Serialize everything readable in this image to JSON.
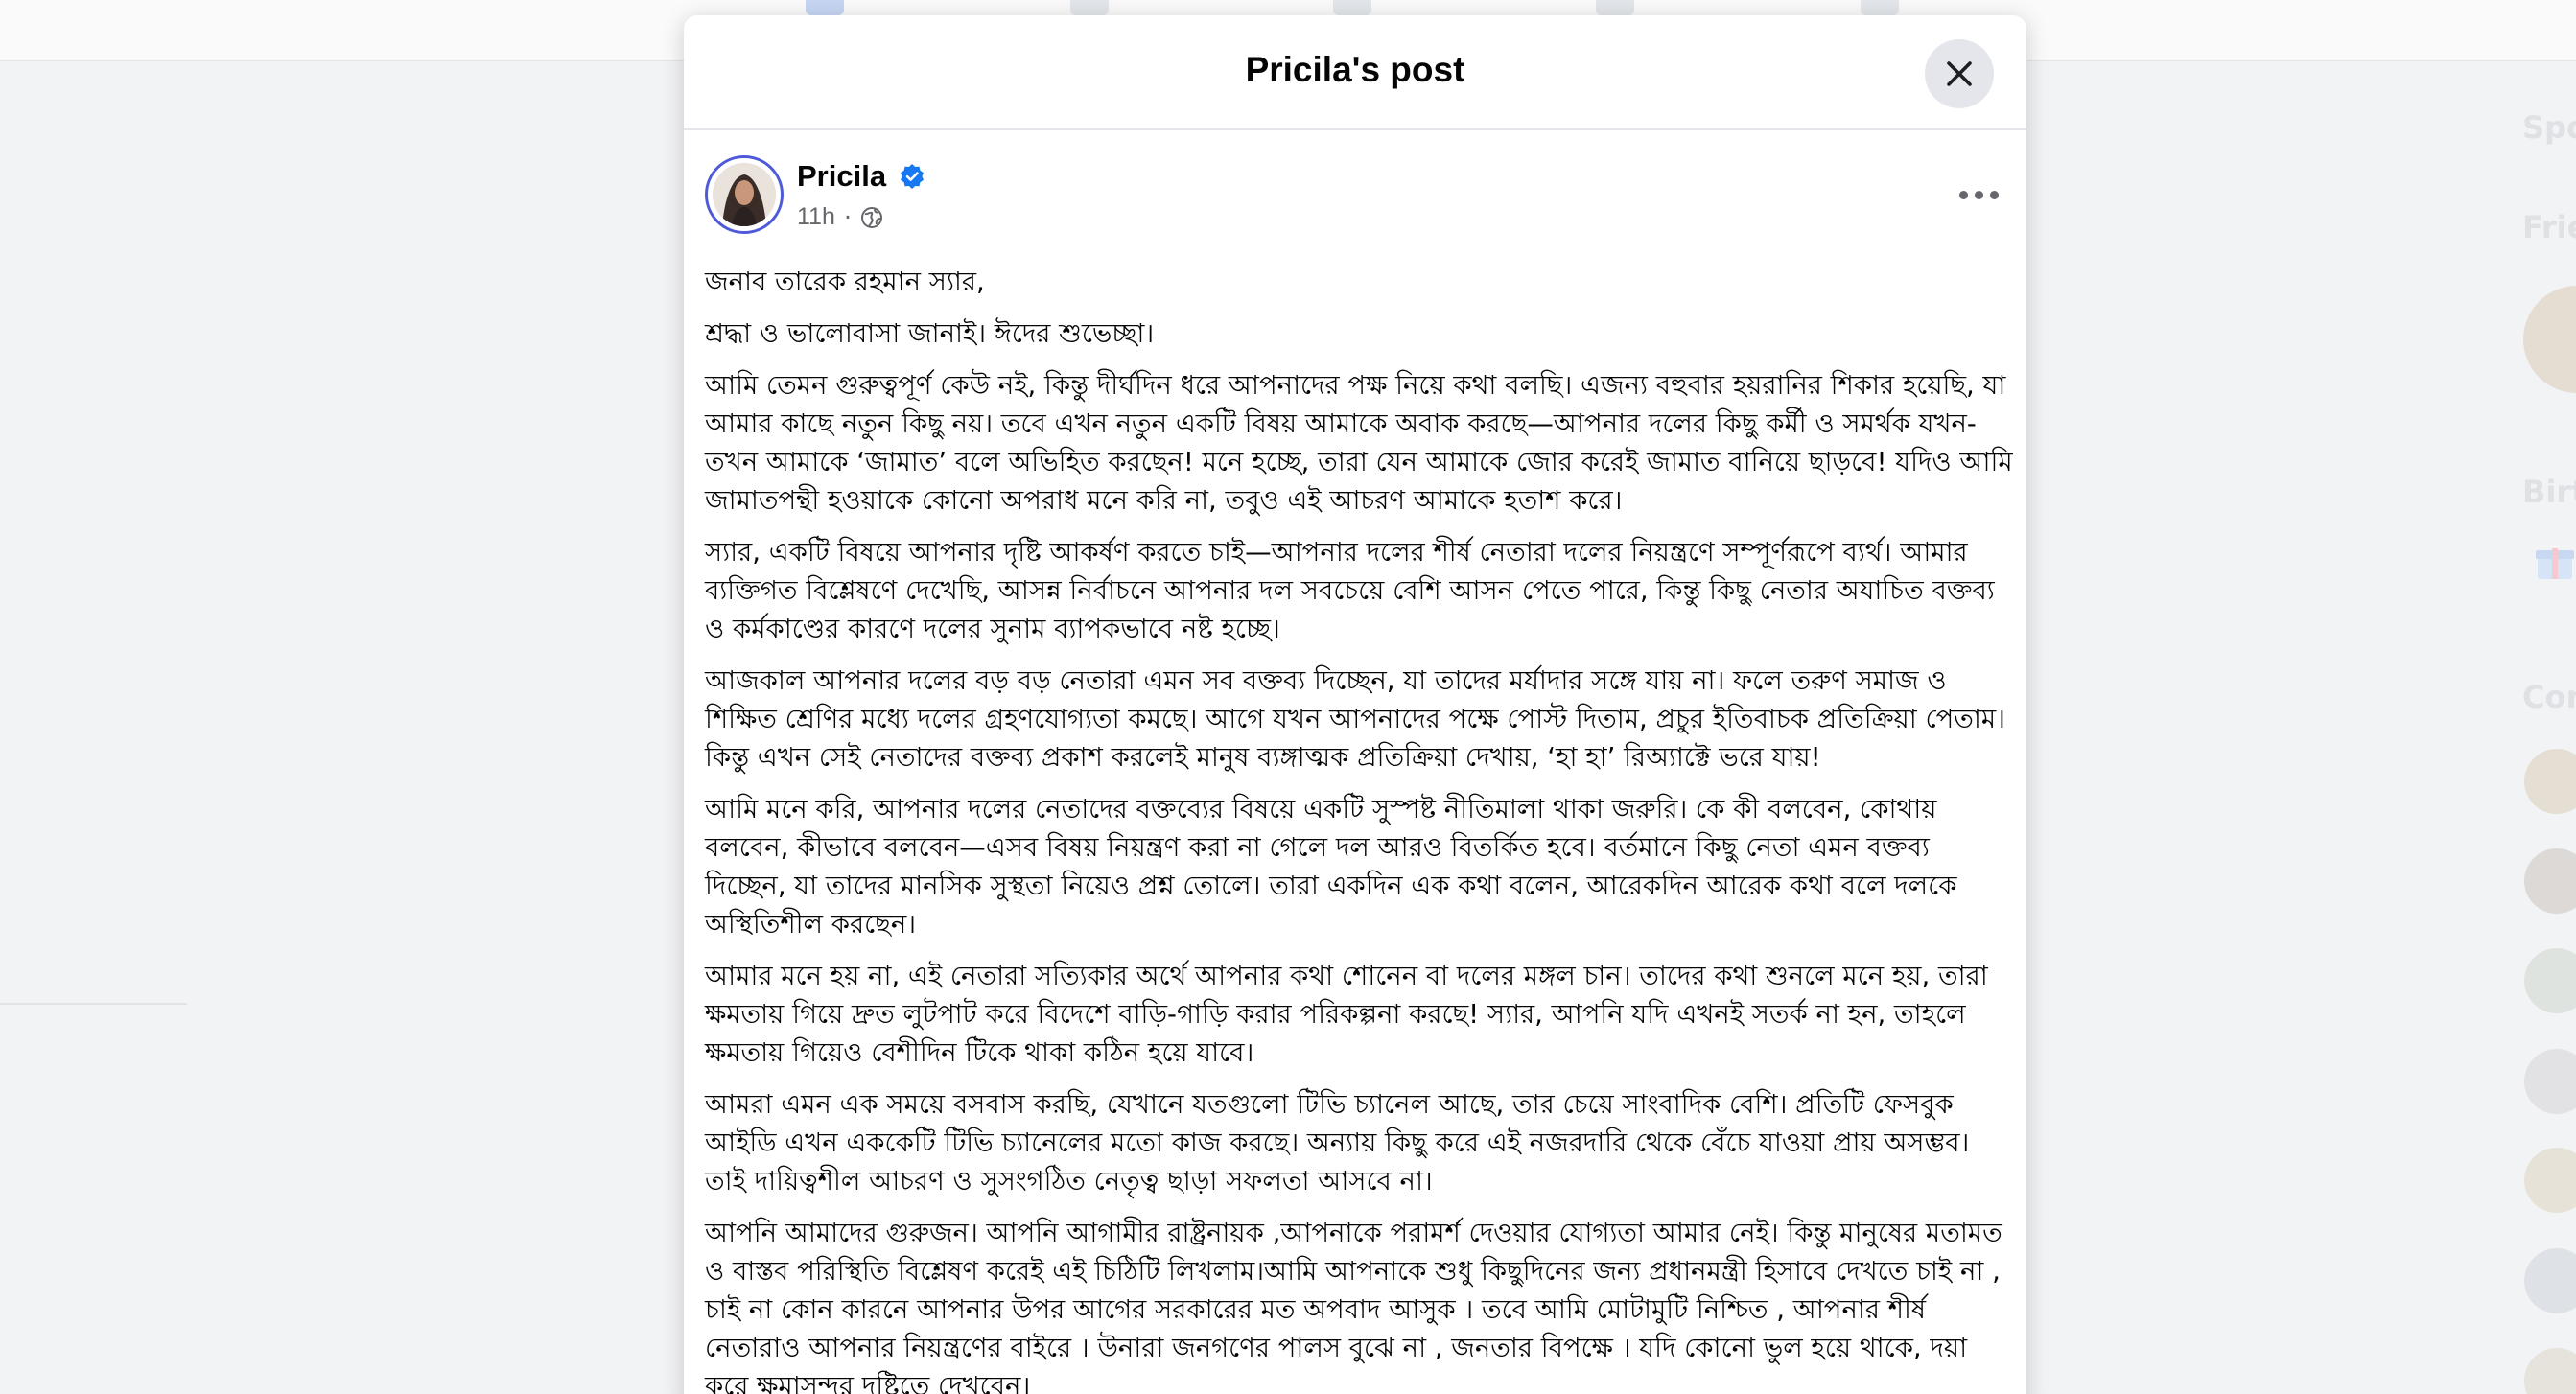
{
  "modal": {
    "title": "Pricila's post",
    "close_icon": "close-icon"
  },
  "post": {
    "author": "Pricila",
    "verified_icon": "verified-badge-icon",
    "time": "11h",
    "separator": "·",
    "privacy_icon": "globe-icon",
    "more_icon": "more-options-icon",
    "paragraphs": [
      "জনাব তারেক রহমান স্যার,",
      "শ্রদ্ধা ও ভালোবাসা জানাই। ঈদের শুভেচ্ছা।",
      "আমি তেমন গুরুত্বপূর্ণ কেউ নই, কিন্তু দীর্ঘদিন ধরে আপনাদের পক্ষ নিয়ে কথা বলছি। এজন্য বহুবার হয়রানির শিকার হয়েছি, যা আমার কাছে নতুন কিছু নয়। তবে এখন নতুন একটি বিষয় আমাকে অবাক করছে—আপনার দলের কিছু কর্মী ও সমর্থক যখন-তখন আমাকে ‘জামাত’ বলে অভিহিত করছেন! মনে হচ্ছে, তারা যেন আমাকে জোর করেই জামাত বানিয়ে ছাড়বে! যদিও আমি জামাতপন্থী হওয়াকে কোনো অপরাধ মনে করি না, তবুও এই আচরণ আমাকে হতাশ করে।",
      "স্যার, একটি বিষয়ে আপনার দৃষ্টি আকর্ষণ করতে চাই—আপনার দলের শীর্ষ নেতারা দলের নিয়ন্ত্রণে সম্পূর্ণরূপে ব্যর্থ। আমার ব্যক্তিগত বিশ্লেষণে দেখেছি, আসন্ন নির্বাচনে আপনার দল সবচেয়ে বেশি আসন পেতে পারে, কিন্তু কিছু নেতার অযাচিত বক্তব্য ও কর্মকাণ্ডের কারণে দলের সুনাম ব্যাপকভাবে নষ্ট হচ্ছে।",
      "আজকাল আপনার দলের বড় বড় নেতারা এমন সব বক্তব্য দিচ্ছেন, যা তাদের মর্যাদার সঙ্গে যায় না। ফলে তরুণ সমাজ ও শিক্ষিত শ্রেণির মধ্যে দলের গ্রহণযোগ্যতা কমছে। আগে যখন আপনাদের পক্ষে পোস্ট দিতাম, প্রচুর ইতিবাচক প্রতিক্রিয়া পেতাম। কিন্তু এখন সেই নেতাদের বক্তব্য প্রকাশ করলেই মানুষ ব্যঙ্গাত্মক প্রতিক্রিয়া দেখায়, ‘হা হা’ রিঅ্যাক্টে ভরে যায়!",
      "আমি মনে করি, আপনার দলের নেতাদের বক্তব্যের বিষয়ে একটি সুস্পষ্ট নীতিমালা থাকা জরুরি। কে কী বলবেন, কোথায় বলবেন, কীভাবে বলবেন—এসব বিষয় নিয়ন্ত্রণ করা না গেলে দল আরও বিতর্কিত হবে। বর্তমানে কিছু নেতা এমন বক্তব্য দিচ্ছেন, যা তাদের মানসিক সুস্থতা নিয়েও প্রশ্ন তোলে। তারা একদিন এক কথা বলেন, আরেকদিন আরেক কথা বলে দলকে অস্থিতিশীল করছেন।",
      "আমার মনে হয় না, এই নেতারা সত্যিকার অর্থে আপনার কথা শোনেন বা দলের মঙ্গল চান। তাদের কথা শুনলে মনে হয়, তারা ক্ষমতায় গিয়ে দ্রুত লুটপাট করে বিদেশে বাড়ি-গাড়ি করার পরিকল্পনা করছে! স্যার, আপনি যদি এখনই সতর্ক না হন, তাহলে ক্ষমতায় গিয়েও বেশীদিন টিকে থাকা কঠিন হয়ে যাবে।",
      "আমরা এমন এক সময়ে বসবাস করছি, যেখানে যতগুলো টিভি চ্যানেল আছে, তার চেয়ে সাংবাদিক বেশি। প্রতিটি ফেসবুক আইডি এখন এককেটি টিভি চ্যানেলের মতো কাজ করছে। অন্যায় কিছু করে এই নজরদারি থেকে বেঁচে যাওয়া প্রায় অসম্ভব। তাই দায়িত্বশীল আচরণ ও সুসংগঠিত নেতৃত্ব ছাড়া সফলতা আসবে না।",
      "আপনি আমাদের গুরুজন। আপনি আগামীর রাষ্ট্রনায়ক ,আপনাকে পরামর্শ দেওয়ার যোগ্যতা আমার নেই। কিন্তু মানুষের মতামত ও বাস্তব পরিস্থিতি বিশ্লেষণ করেই এই চিঠিটি লিখলাম।আমি আপনাকে শুধু কিছুদিনের জন্য প্রধানমন্ত্রী হিসাবে দেখতে চাই না , চাই না কোন কারনে আপনার উপর আগের সরকারের মত অপবাদ আসুক । তবে আমি মোটামুটি নিশ্চিত , আপনার শীর্ষ নেতারাও আপনার নিয়ন্ত্রণের বাইরে । উনারা জনগণের পালস বুঝে না , জনতার বিপক্ষে । যদি কোনো ভুল হয়ে থাকে, দয়া করে ক্ষমাসুন্দর দৃষ্টিতে দেখবেন।"
    ]
  },
  "background": {
    "right_rail_headings": [
      "Spo",
      "Frie",
      "Birt",
      "Con"
    ]
  }
}
